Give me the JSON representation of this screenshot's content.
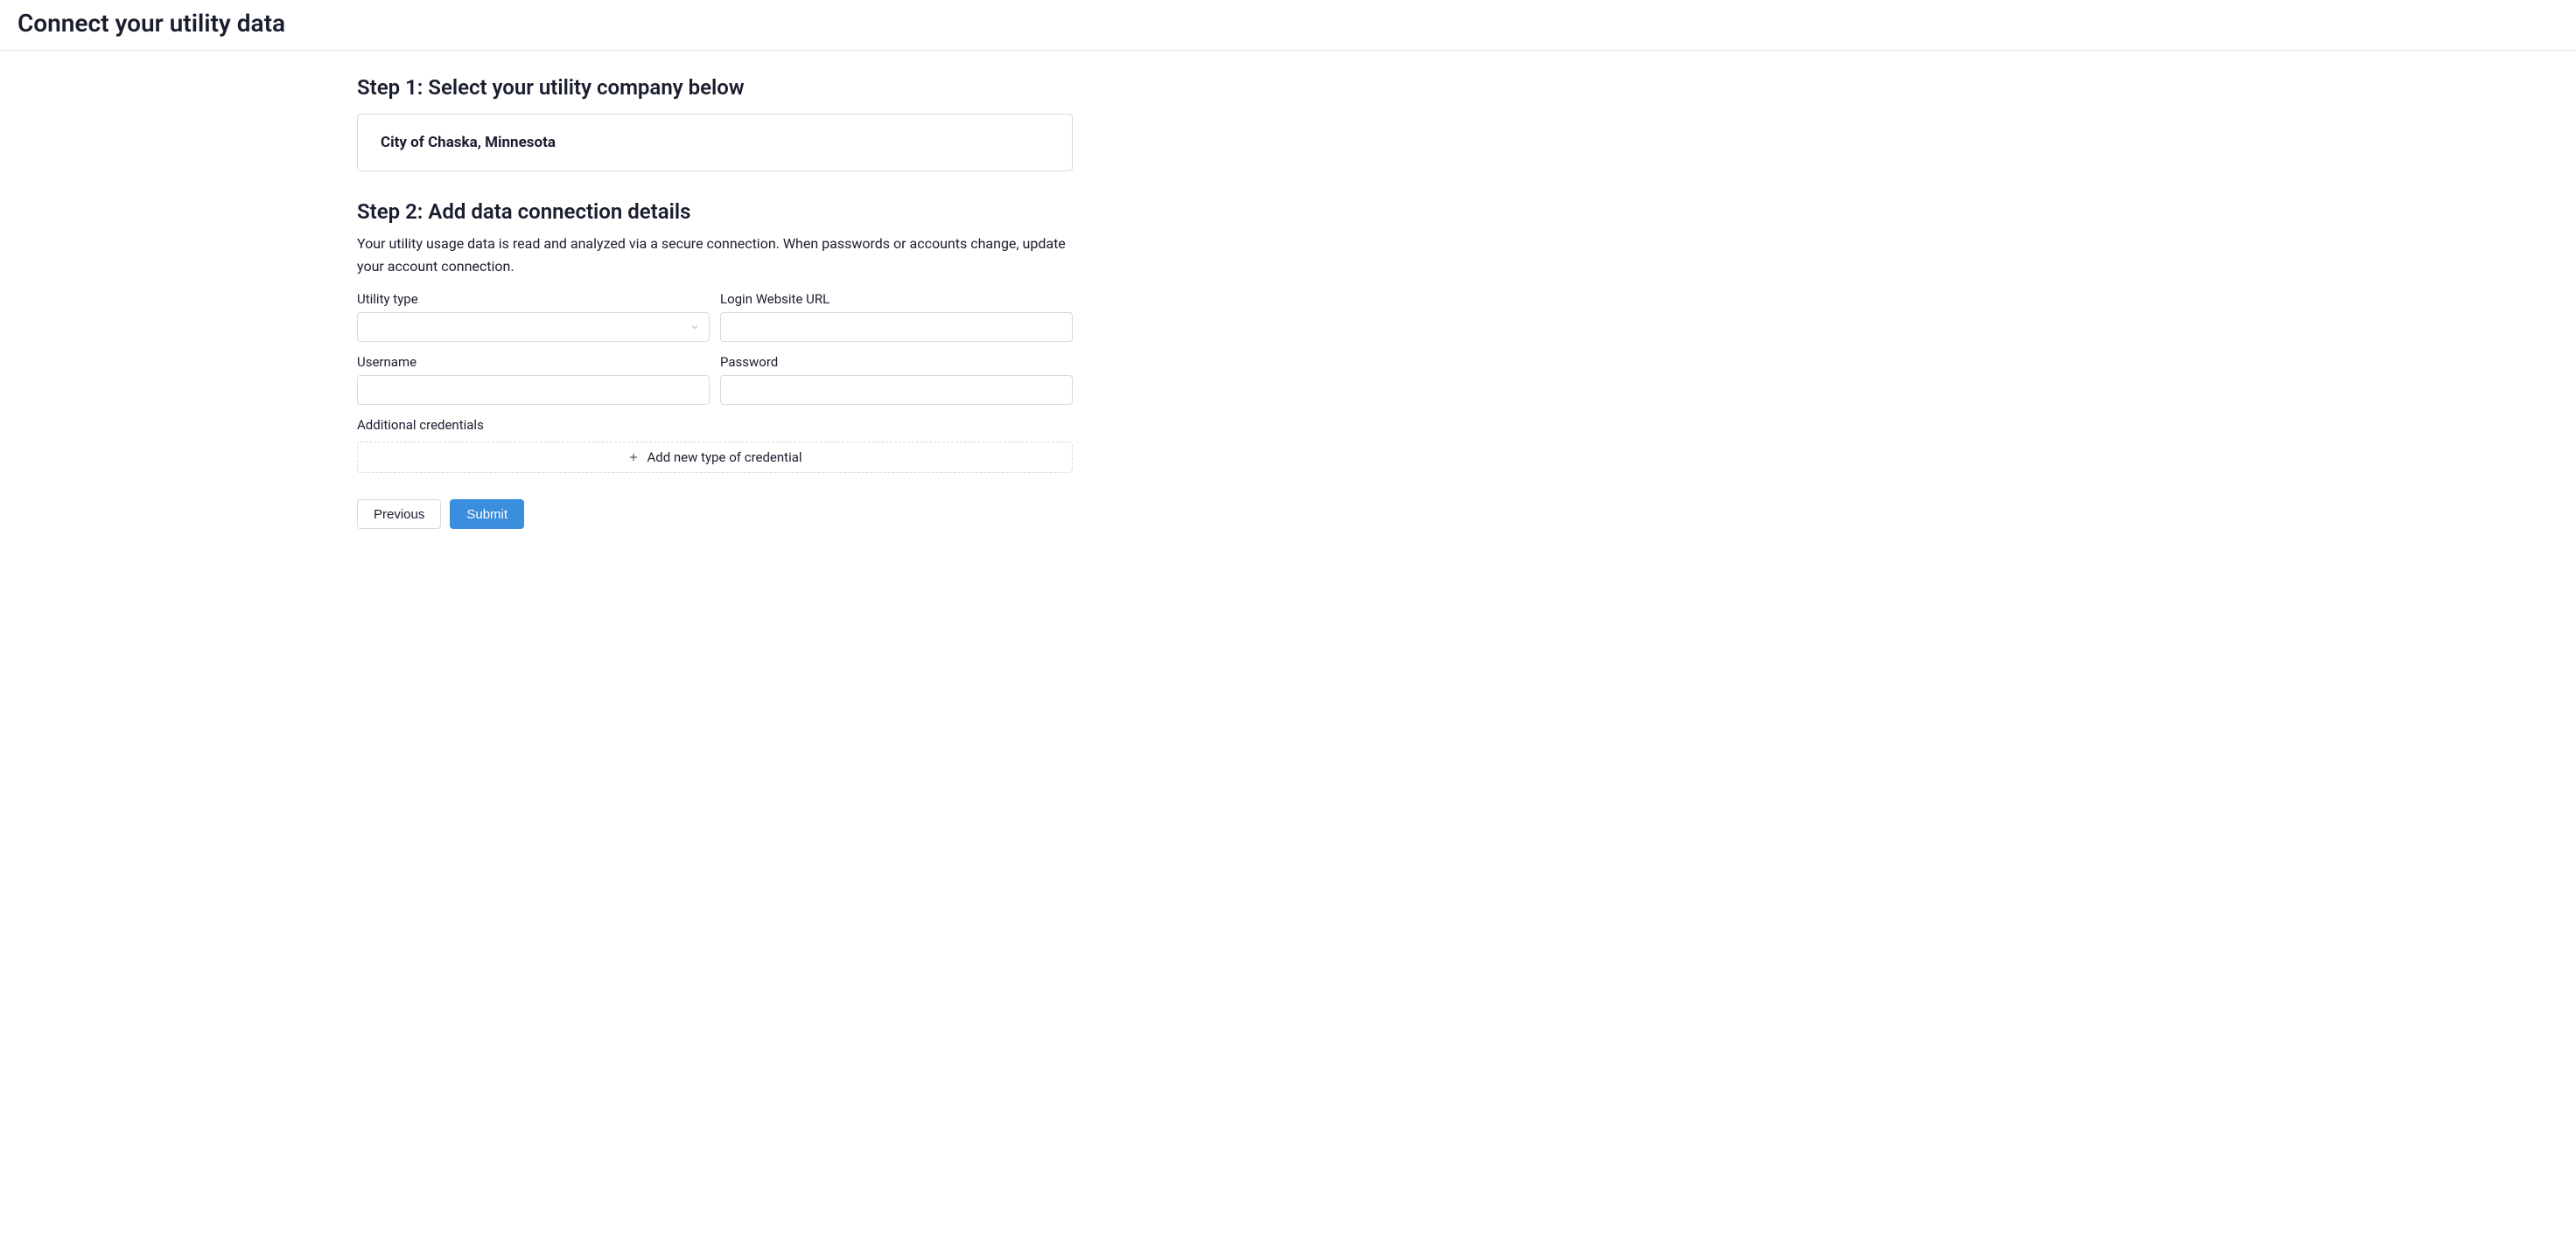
{
  "header": {
    "title": "Connect your utility data"
  },
  "step1": {
    "title": "Step 1: Select your utility company below",
    "selected_company": "City of Chaska, Minnesota"
  },
  "step2": {
    "title": "Step 2: Add data connection details",
    "description": "Your utility usage data is read and analyzed via a secure connection. When passwords or accounts change, update your account connection.",
    "fields": {
      "utility_type_label": "Utility type",
      "utility_type_value": "",
      "login_url_label": "Login Website URL",
      "login_url_value": "",
      "username_label": "Username",
      "username_value": "",
      "password_label": "Password",
      "password_value": ""
    },
    "additional_credentials_label": "Additional credentials",
    "add_credential_label": "Add new type of credential"
  },
  "buttons": {
    "previous": "Previous",
    "submit": "Submit"
  }
}
